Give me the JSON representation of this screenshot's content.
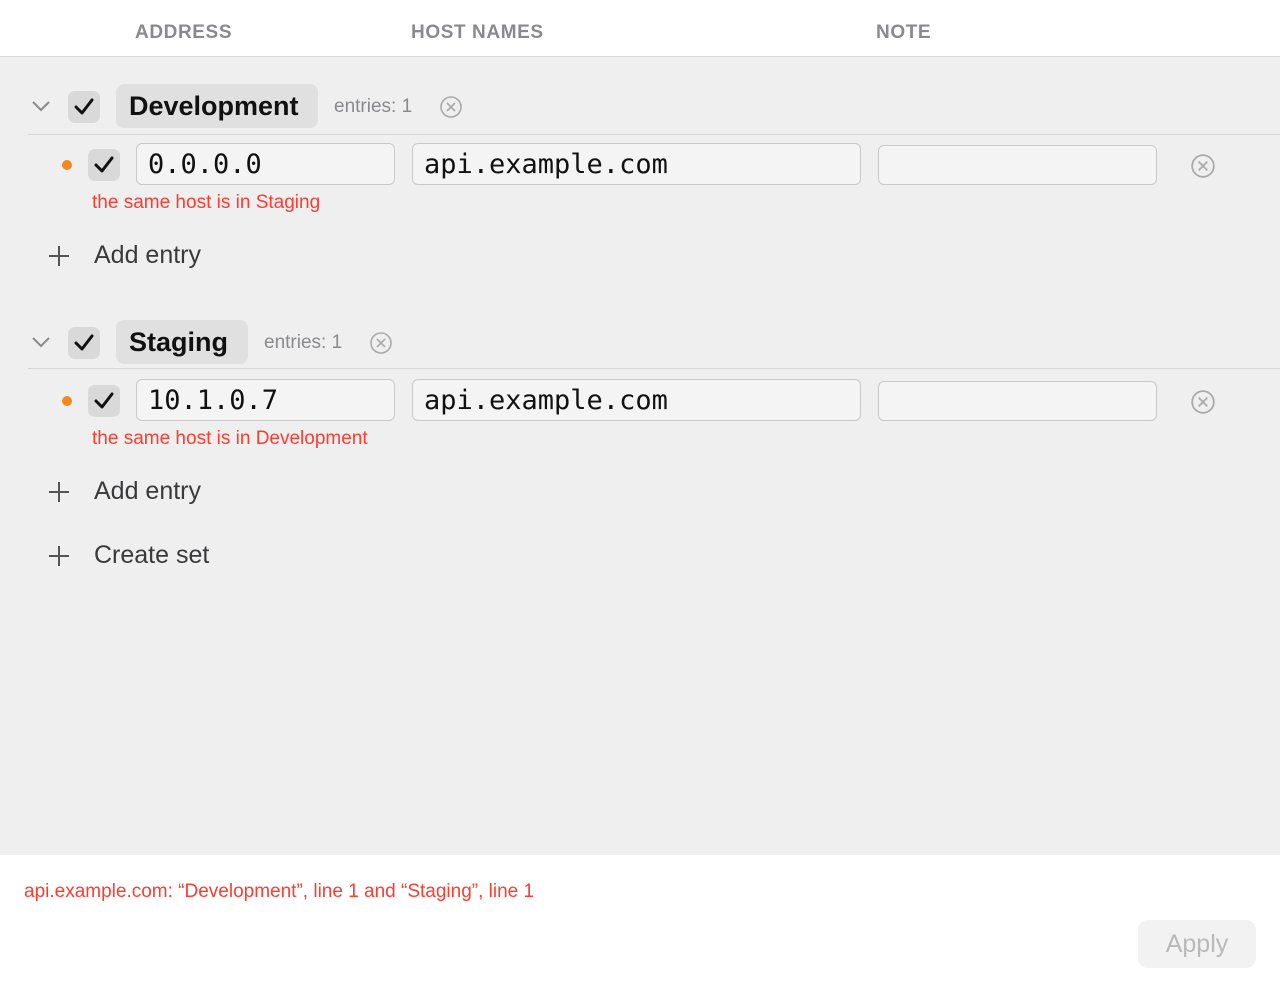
{
  "columns": {
    "address": "ADDRESS",
    "host_names": "HOST NAMES",
    "note": "NOTE"
  },
  "sets": [
    {
      "name": "Development",
      "enabled": true,
      "entries_label": "entries: 1",
      "entries": [
        {
          "enabled": true,
          "address": "0.0.0.0",
          "host_names": "api.example.com",
          "note": "",
          "error": "the same host is in Staging"
        }
      ],
      "add_entry_label": "Add entry"
    },
    {
      "name": "Staging",
      "enabled": true,
      "entries_label": "entries: 1",
      "entries": [
        {
          "enabled": true,
          "address": "10.1.0.7",
          "host_names": "api.example.com",
          "note": "",
          "error": "the same host is in Development"
        }
      ],
      "add_entry_label": "Add entry"
    }
  ],
  "create_set_label": "Create set",
  "footer": {
    "error": "api.example.com: “Development”, line 1 and “Staging”, line 1",
    "apply_label": "Apply"
  },
  "colors": {
    "warning_dot": "#f5871f",
    "error_text": "#ff3b30",
    "checkbox_bg": "#d9d9d9",
    "content_bg": "#efefef"
  },
  "icons": {
    "collapse": "chevron-down-icon",
    "checked": "checkmark-icon",
    "remove": "circle-x-icon",
    "add": "plus-icon"
  }
}
